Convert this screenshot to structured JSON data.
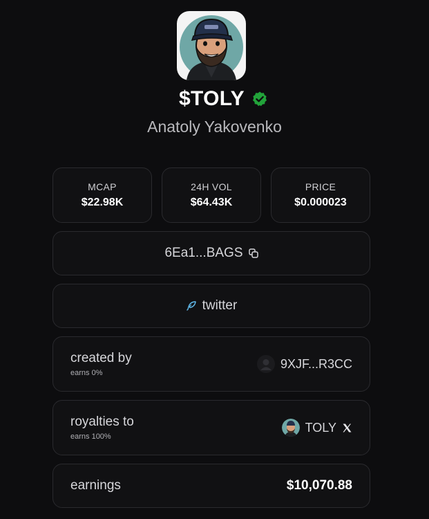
{
  "token": {
    "ticker": "$TOLY",
    "name": "Anatoly Yakovenko",
    "verified_color": "#22a33a"
  },
  "stats": [
    {
      "label": "MCAP",
      "value": "$22.98K"
    },
    {
      "label": "24H VOL",
      "value": "$64.43K"
    },
    {
      "label": "PRICE",
      "value": "$0.000023"
    }
  ],
  "contract": {
    "address": "6Ea1...BAGS",
    "icon": "copy-icon"
  },
  "social": {
    "label": "twitter",
    "icon": "feather-icon"
  },
  "created_by": {
    "title": "created by",
    "sub": "earns 0%",
    "address": "9XJF...R3CC",
    "icon": "user-placeholder-icon"
  },
  "royalties": {
    "title": "royalties to",
    "sub": "earns 100%",
    "handle": "TOLY",
    "icon": "x-logo-icon"
  },
  "earnings": {
    "title": "earnings",
    "value": "$10,070.88"
  }
}
